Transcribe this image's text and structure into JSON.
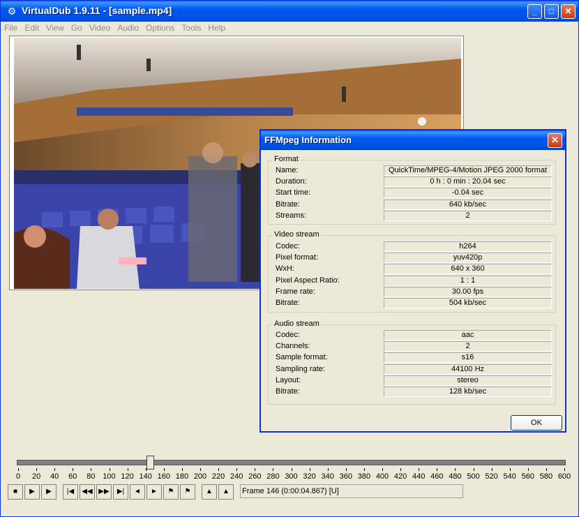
{
  "window": {
    "title": "VirtualDub 1.9.11 - [sample.mp4]"
  },
  "menu": [
    "File",
    "Edit",
    "View",
    "Go",
    "Video",
    "Audio",
    "Options",
    "Tools",
    "Help"
  ],
  "timeline": {
    "labels": [
      "0",
      "20",
      "40",
      "60",
      "80",
      "100",
      "120",
      "140",
      "160",
      "180",
      "200",
      "220",
      "240",
      "260",
      "280",
      "300",
      "320",
      "340",
      "360",
      "380",
      "400",
      "420",
      "440",
      "460",
      "480",
      "500",
      "520",
      "540",
      "560",
      "580",
      "600"
    ],
    "position_frame": 146,
    "max": 600
  },
  "status": {
    "frame_text": "Frame 146 (0:00:04.867) [U]"
  },
  "dialog": {
    "title": "FFMpeg Information",
    "ok_label": "OK",
    "format": {
      "label": "Format",
      "rows": [
        {
          "k": "Name:",
          "v": "QuickTime/MPEG-4/Motion JPEG 2000 format"
        },
        {
          "k": "Duration:",
          "v": "0 h : 0 min : 20.04 sec"
        },
        {
          "k": "Start time:",
          "v": "-0.04 sec"
        },
        {
          "k": "Bitrate:",
          "v": "640 kb/sec"
        },
        {
          "k": "Streams:",
          "v": "2"
        }
      ]
    },
    "video": {
      "label": "Video stream",
      "rows": [
        {
          "k": "Codec:",
          "v": "h264"
        },
        {
          "k": "Pixel format:",
          "v": "yuv420p"
        },
        {
          "k": "WxH:",
          "v": "640 x 360"
        },
        {
          "k": "Pixel Aspect Ratio:",
          "v": "1 : 1"
        },
        {
          "k": "Frame rate:",
          "v": "30.00 fps"
        },
        {
          "k": "Bitrate:",
          "v": "504 kb/sec"
        }
      ]
    },
    "audio": {
      "label": "Audio stream",
      "rows": [
        {
          "k": "Codec:",
          "v": "aac"
        },
        {
          "k": "Channels:",
          "v": "2"
        },
        {
          "k": "Sample format:",
          "v": "s16"
        },
        {
          "k": "Sampling rate:",
          "v": "44100 Hz"
        },
        {
          "k": "Layout:",
          "v": "stereo"
        },
        {
          "k": "Bitrate:",
          "v": "128 kb/sec"
        }
      ]
    }
  }
}
